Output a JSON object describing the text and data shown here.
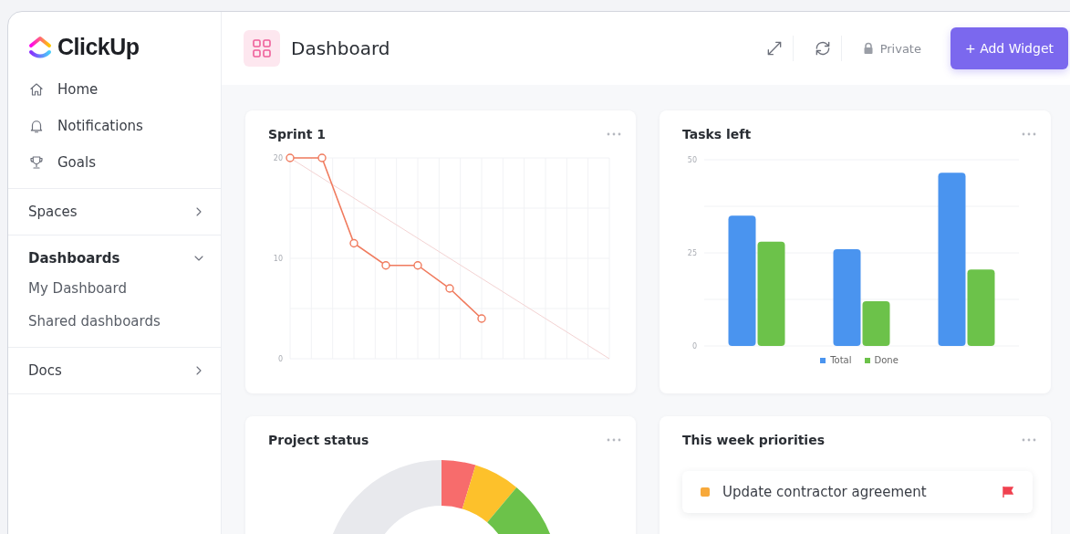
{
  "sidebar": {
    "logo": "ClickUp",
    "nav": [
      {
        "label": "Home",
        "kind": "home"
      },
      {
        "label": "Notifications",
        "kind": "bell"
      },
      {
        "label": "Goals",
        "kind": "trophy"
      }
    ],
    "sections": [
      {
        "label": "Spaces",
        "expanded": false,
        "selected": false
      },
      {
        "label": "Dashboards",
        "expanded": true,
        "selected": true,
        "children": [
          {
            "label": "My Dashboard"
          },
          {
            "label": "Shared dashboards"
          }
        ]
      },
      {
        "label": "Docs",
        "expanded": false,
        "selected": false
      }
    ]
  },
  "header": {
    "title": "Dashboard",
    "privacy": "Private",
    "add_button": "+ Add Widget"
  },
  "widgets": [
    {
      "kind": "chart",
      "title": "Sprint 1",
      "chart_data": {
        "type": "line",
        "categories": [
          null,
          null,
          null,
          null,
          null,
          null,
          null,
          null,
          null,
          null,
          null
        ],
        "ylim": [
          0,
          20
        ],
        "yticks": [
          0,
          10,
          20
        ],
        "grid": true,
        "series": [
          {
            "color": "#f07b5e",
            "marker": "circle",
            "values": [
              20,
              20,
              11.5,
              9.3,
              9.3,
              7,
              4,
              null,
              null,
              null,
              null
            ]
          },
          {
            "color": "#f3d3d3",
            "values": [
              20,
              18,
              16,
              14,
              12,
              10,
              8,
              6,
              4,
              2,
              0
            ]
          }
        ]
      }
    },
    {
      "kind": "chart",
      "title": "Tasks left",
      "chart_data": {
        "type": "bar",
        "ylim": [
          0,
          50
        ],
        "yticks": [
          0,
          25,
          50
        ],
        "legend": "bottom",
        "grid": true,
        "series": [
          {
            "name": "Total",
            "color": "#4a94ef",
            "values": [
              35,
              26,
              46.5
            ]
          },
          {
            "name": "Done",
            "color": "#6cc24a",
            "values": [
              28,
              12,
              20.5
            ]
          }
        ]
      }
    },
    {
      "kind": "donut",
      "title": "Project status"
    },
    {
      "kind": "list",
      "title": "This week priorities",
      "items": [
        {
          "label": "Update contractor agreement",
          "color": "#f7a93b"
        }
      ]
    }
  ]
}
